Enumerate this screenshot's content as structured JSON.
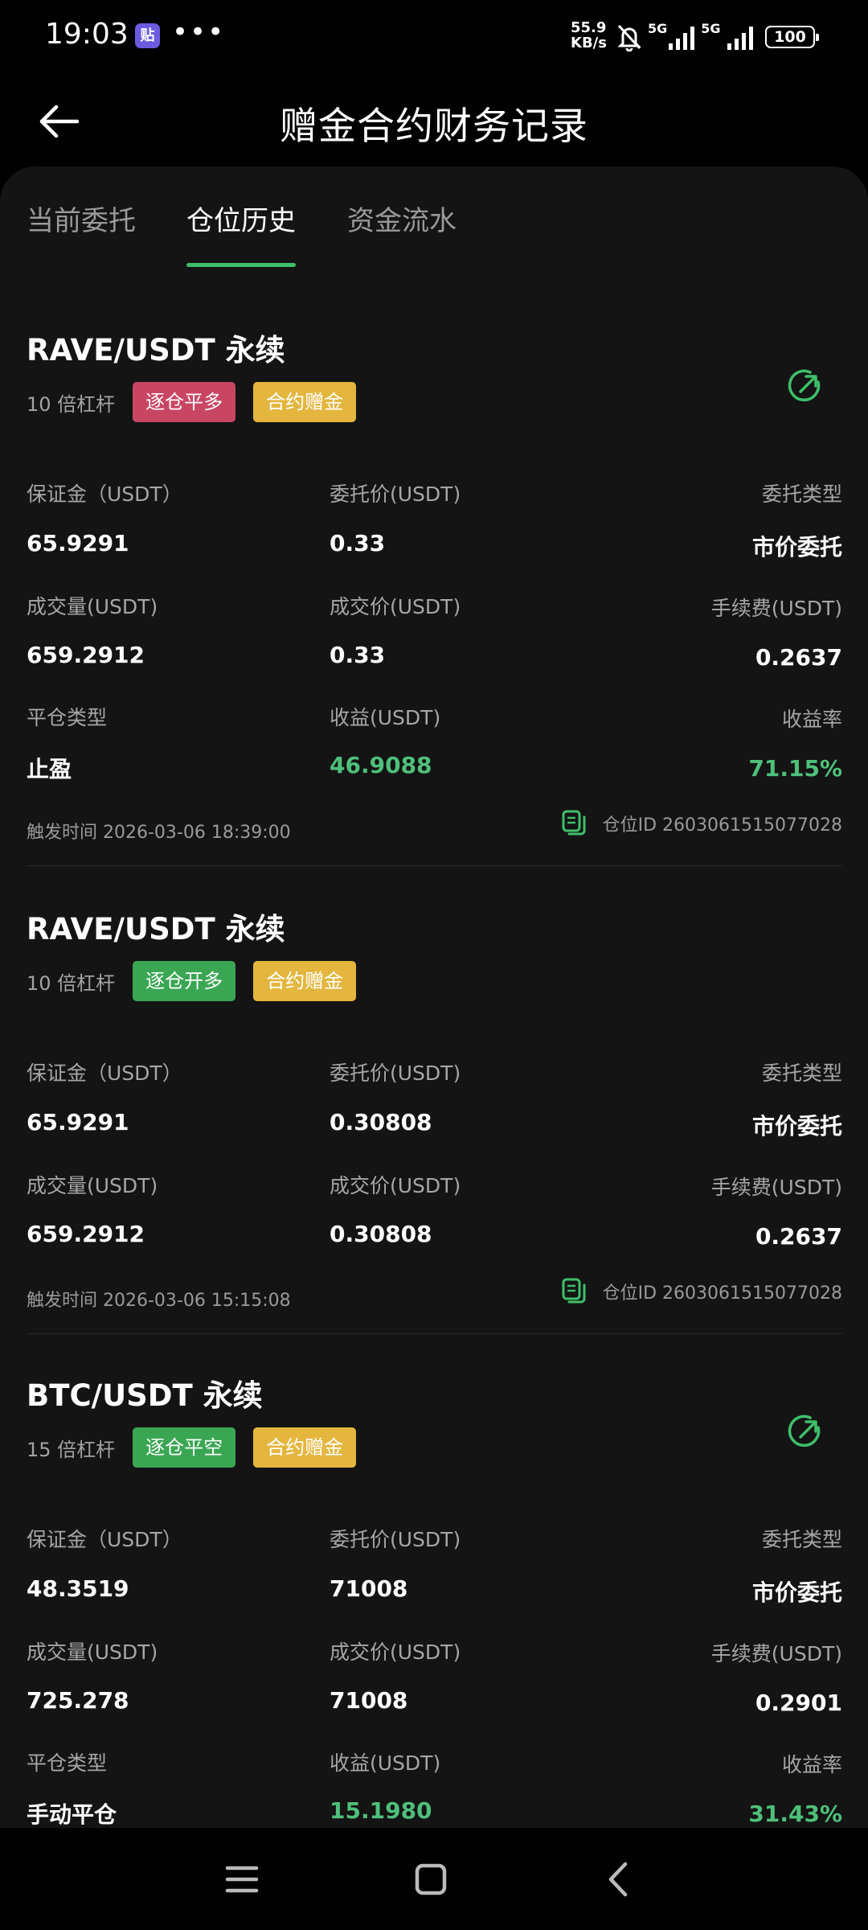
{
  "status_bar": {
    "time": "19:03",
    "app_icon_text": "贴",
    "dots": "•••",
    "net_speed_value": "55.9",
    "net_speed_unit": "KB/s",
    "signal_1": "5G",
    "signal_2": "5G",
    "battery": "100"
  },
  "header": {
    "title": "赠金合约财务记录"
  },
  "tabs": [
    {
      "label": "当前委托",
      "active": false
    },
    {
      "label": "仓位历史",
      "active": true
    },
    {
      "label": "资金流水",
      "active": false
    }
  ],
  "cards": [
    {
      "pair": "RAVE/USDT 永续",
      "leverage": "10 倍杠杆",
      "tags": [
        {
          "text": "逐仓平多",
          "color": "#c94663"
        },
        {
          "text": "合约赠金",
          "color": "#e4b63e"
        }
      ],
      "margin_label": "保证金（USDT）",
      "margin": "65.9291",
      "order_price_label": "委托价(USDT)",
      "order_price": "0.33",
      "order_type_label": "委托类型",
      "order_type": "市价委托",
      "volume_label": "成交量(USDT)",
      "volume": "659.2912",
      "fill_price_label": "成交价(USDT)",
      "fill_price": "0.33",
      "fee_label": "手续费(USDT)",
      "fee": "0.2637",
      "close_type_label": "平仓类型",
      "close_type": "止盈",
      "pnl_label": "收益(USDT)",
      "pnl": "46.9088",
      "roi_label": "收益率",
      "roi": "71.15%",
      "trigger_time": "触发时间 2026-03-06 18:39:00",
      "position_id": "仓位ID 2603061515077028"
    },
    {
      "pair": "RAVE/USDT 永续",
      "leverage": "10 倍杠杆",
      "tags": [
        {
          "text": "逐仓开多",
          "color": "#3aa653"
        },
        {
          "text": "合约赠金",
          "color": "#e4b63e"
        }
      ],
      "margin_label": "保证金（USDT）",
      "margin": "65.9291",
      "order_price_label": "委托价(USDT)",
      "order_price": "0.30808",
      "order_type_label": "委托类型",
      "order_type": "市价委托",
      "volume_label": "成交量(USDT)",
      "volume": "659.2912",
      "fill_price_label": "成交价(USDT)",
      "fill_price": "0.30808",
      "fee_label": "手续费(USDT)",
      "fee": "0.2637",
      "trigger_time": "触发时间 2026-03-06 15:15:08",
      "position_id": "仓位ID 2603061515077028"
    },
    {
      "pair": "BTC/USDT 永续",
      "leverage": "15 倍杠杆",
      "tags": [
        {
          "text": "逐仓平空",
          "color": "#3aa653"
        },
        {
          "text": "合约赠金",
          "color": "#e4b63e"
        }
      ],
      "margin_label": "保证金（USDT）",
      "margin": "48.3519",
      "order_price_label": "委托价(USDT)",
      "order_price": "71008",
      "order_type_label": "委托类型",
      "order_type": "市价委托",
      "volume_label": "成交量(USDT)",
      "volume": "725.278",
      "fill_price_label": "成交价(USDT)",
      "fill_price": "71008",
      "fee_label": "手续费(USDT)",
      "fee": "0.2901",
      "close_type_label": "平仓类型",
      "close_type": "手动平仓",
      "pnl_label": "收益(USDT)",
      "pnl": "15.1980",
      "roi_label": "收益率",
      "roi": "31.43%"
    }
  ],
  "colors": {
    "accent_green": "#3fbf6a",
    "profit_green": "#4ec07a",
    "panel_bg": "#141414"
  },
  "icons": {
    "back": "arrow-left-icon",
    "share": "share-icon",
    "copy": "copy-icon"
  }
}
